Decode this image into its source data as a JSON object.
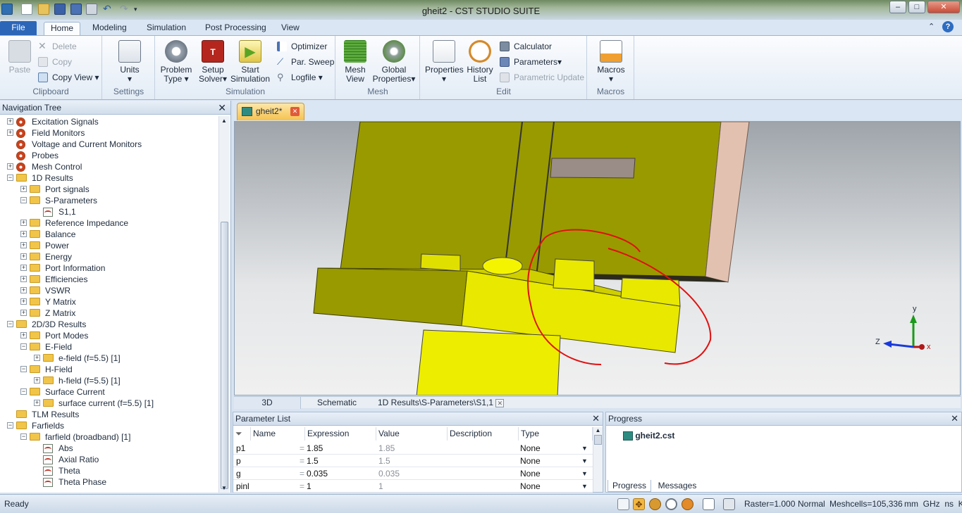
{
  "window": {
    "title": "gheit2 - CST STUDIO SUITE",
    "minimize": "–",
    "maximize": "□",
    "close": "✕"
  },
  "tabs": {
    "file": "File",
    "home": "Home",
    "modeling": "Modeling",
    "simulation": "Simulation",
    "post": "Post Processing",
    "view": "View"
  },
  "ribbon": {
    "clipboard": {
      "label": "Clipboard",
      "paste": "Paste",
      "delete": "Delete",
      "copy": "Copy",
      "copy_view": "Copy View"
    },
    "settings": {
      "label": "Settings",
      "units": "Units"
    },
    "simulation": {
      "label": "Simulation",
      "problem_type": "Problem Type",
      "setup_solver": "Setup Solver",
      "start": "Start Simulation",
      "optimizer": "Optimizer",
      "par_sweep": "Par. Sweep",
      "logfile": "Logfile"
    },
    "mesh": {
      "label": "Mesh",
      "mesh_view": "Mesh View",
      "global_props": "Global Properties"
    },
    "edit": {
      "label": "Edit",
      "properties": "Properties",
      "history": "History List",
      "calculator": "Calculator",
      "parameters": "Parameters",
      "param_update": "Parametric Update"
    },
    "macros": {
      "label": "Macros",
      "macros": "Macros"
    }
  },
  "nav": {
    "title": "Navigation Tree",
    "items": [
      {
        "label": "Excitation Signals",
        "level": 0,
        "icon": "gear",
        "exp": "+"
      },
      {
        "label": "Field Monitors",
        "level": 0,
        "icon": "gear",
        "exp": "+"
      },
      {
        "label": "Voltage and Current Monitors",
        "level": 0,
        "icon": "gear",
        "exp": ""
      },
      {
        "label": "Probes",
        "level": 0,
        "icon": "gear",
        "exp": ""
      },
      {
        "label": "Mesh Control",
        "level": 0,
        "icon": "gear",
        "exp": "+"
      },
      {
        "label": "1D Results",
        "level": 0,
        "icon": "folder",
        "exp": "−"
      },
      {
        "label": "Port signals",
        "level": 1,
        "icon": "folder",
        "exp": "+"
      },
      {
        "label": "S-Parameters",
        "level": 1,
        "icon": "folder",
        "exp": "−"
      },
      {
        "label": "S1,1",
        "level": 2,
        "icon": "curve",
        "exp": ""
      },
      {
        "label": "Reference Impedance",
        "level": 1,
        "icon": "folder",
        "exp": "+"
      },
      {
        "label": "Balance",
        "level": 1,
        "icon": "folder",
        "exp": "+"
      },
      {
        "label": "Power",
        "level": 1,
        "icon": "folder",
        "exp": "+"
      },
      {
        "label": "Energy",
        "level": 1,
        "icon": "folder",
        "exp": "+"
      },
      {
        "label": "Port Information",
        "level": 1,
        "icon": "folder",
        "exp": "+"
      },
      {
        "label": "Efficiencies",
        "level": 1,
        "icon": "folder",
        "exp": "+"
      },
      {
        "label": "VSWR",
        "level": 1,
        "icon": "folder",
        "exp": "+"
      },
      {
        "label": "Y Matrix",
        "level": 1,
        "icon": "folder",
        "exp": "+"
      },
      {
        "label": "Z Matrix",
        "level": 1,
        "icon": "folder",
        "exp": "+"
      },
      {
        "label": "2D/3D Results",
        "level": 0,
        "icon": "folder",
        "exp": "−"
      },
      {
        "label": "Port Modes",
        "level": 1,
        "icon": "folder",
        "exp": "+"
      },
      {
        "label": "E-Field",
        "level": 1,
        "icon": "folder",
        "exp": "−"
      },
      {
        "label": "e-field (f=5.5) [1]",
        "level": 2,
        "icon": "folder",
        "exp": "+"
      },
      {
        "label": "H-Field",
        "level": 1,
        "icon": "folder",
        "exp": "−"
      },
      {
        "label": "h-field (f=5.5) [1]",
        "level": 2,
        "icon": "folder",
        "exp": "+"
      },
      {
        "label": "Surface Current",
        "level": 1,
        "icon": "folder",
        "exp": "−"
      },
      {
        "label": "surface current (f=5.5) [1]",
        "level": 2,
        "icon": "folder",
        "exp": "+"
      },
      {
        "label": "TLM Results",
        "level": 0,
        "icon": "folder",
        "exp": ""
      },
      {
        "label": "Farfields",
        "level": 0,
        "icon": "folder",
        "exp": "−"
      },
      {
        "label": "farfield (broadband) [1]",
        "level": 1,
        "icon": "folder",
        "exp": "−"
      },
      {
        "label": "Abs",
        "level": 2,
        "icon": "curve",
        "exp": ""
      },
      {
        "label": "Axial Ratio",
        "level": 2,
        "icon": "curve",
        "exp": ""
      },
      {
        "label": "Theta",
        "level": 2,
        "icon": "curve",
        "exp": ""
      },
      {
        "label": "Theta Phase",
        "level": 2,
        "icon": "curve",
        "exp": ""
      }
    ]
  },
  "doc_tab": {
    "label": "gheit2*"
  },
  "axes": {
    "x": "x",
    "y": "y",
    "z": "z"
  },
  "view_tabs": {
    "t3d": "3D",
    "schematic": "Schematic",
    "result": "1D Results\\S-Parameters\\S1,1"
  },
  "params": {
    "title": "Parameter List",
    "columns": {
      "name": "Name",
      "expression": "Expression",
      "value": "Value",
      "description": "Description",
      "type": "Type"
    },
    "rows": [
      {
        "name": "p1",
        "expression": "1.85",
        "value": "1.85",
        "type": "None"
      },
      {
        "name": "p",
        "expression": "1.5",
        "value": "1.5",
        "type": "None"
      },
      {
        "name": "g",
        "expression": "0.035",
        "value": "0.035",
        "type": "None"
      },
      {
        "name": "pinl",
        "expression": "1",
        "value": "1",
        "type": "None"
      }
    ]
  },
  "progress": {
    "title": "Progress",
    "file": "gheit2.cst",
    "tab_progress": "Progress",
    "tab_messages": "Messages"
  },
  "status": {
    "ready": "Ready",
    "raster": "Raster=1.000",
    "mode": "Normal",
    "meshcells": "Meshcells=105,336",
    "units": "mm  GHz  ns  K"
  }
}
